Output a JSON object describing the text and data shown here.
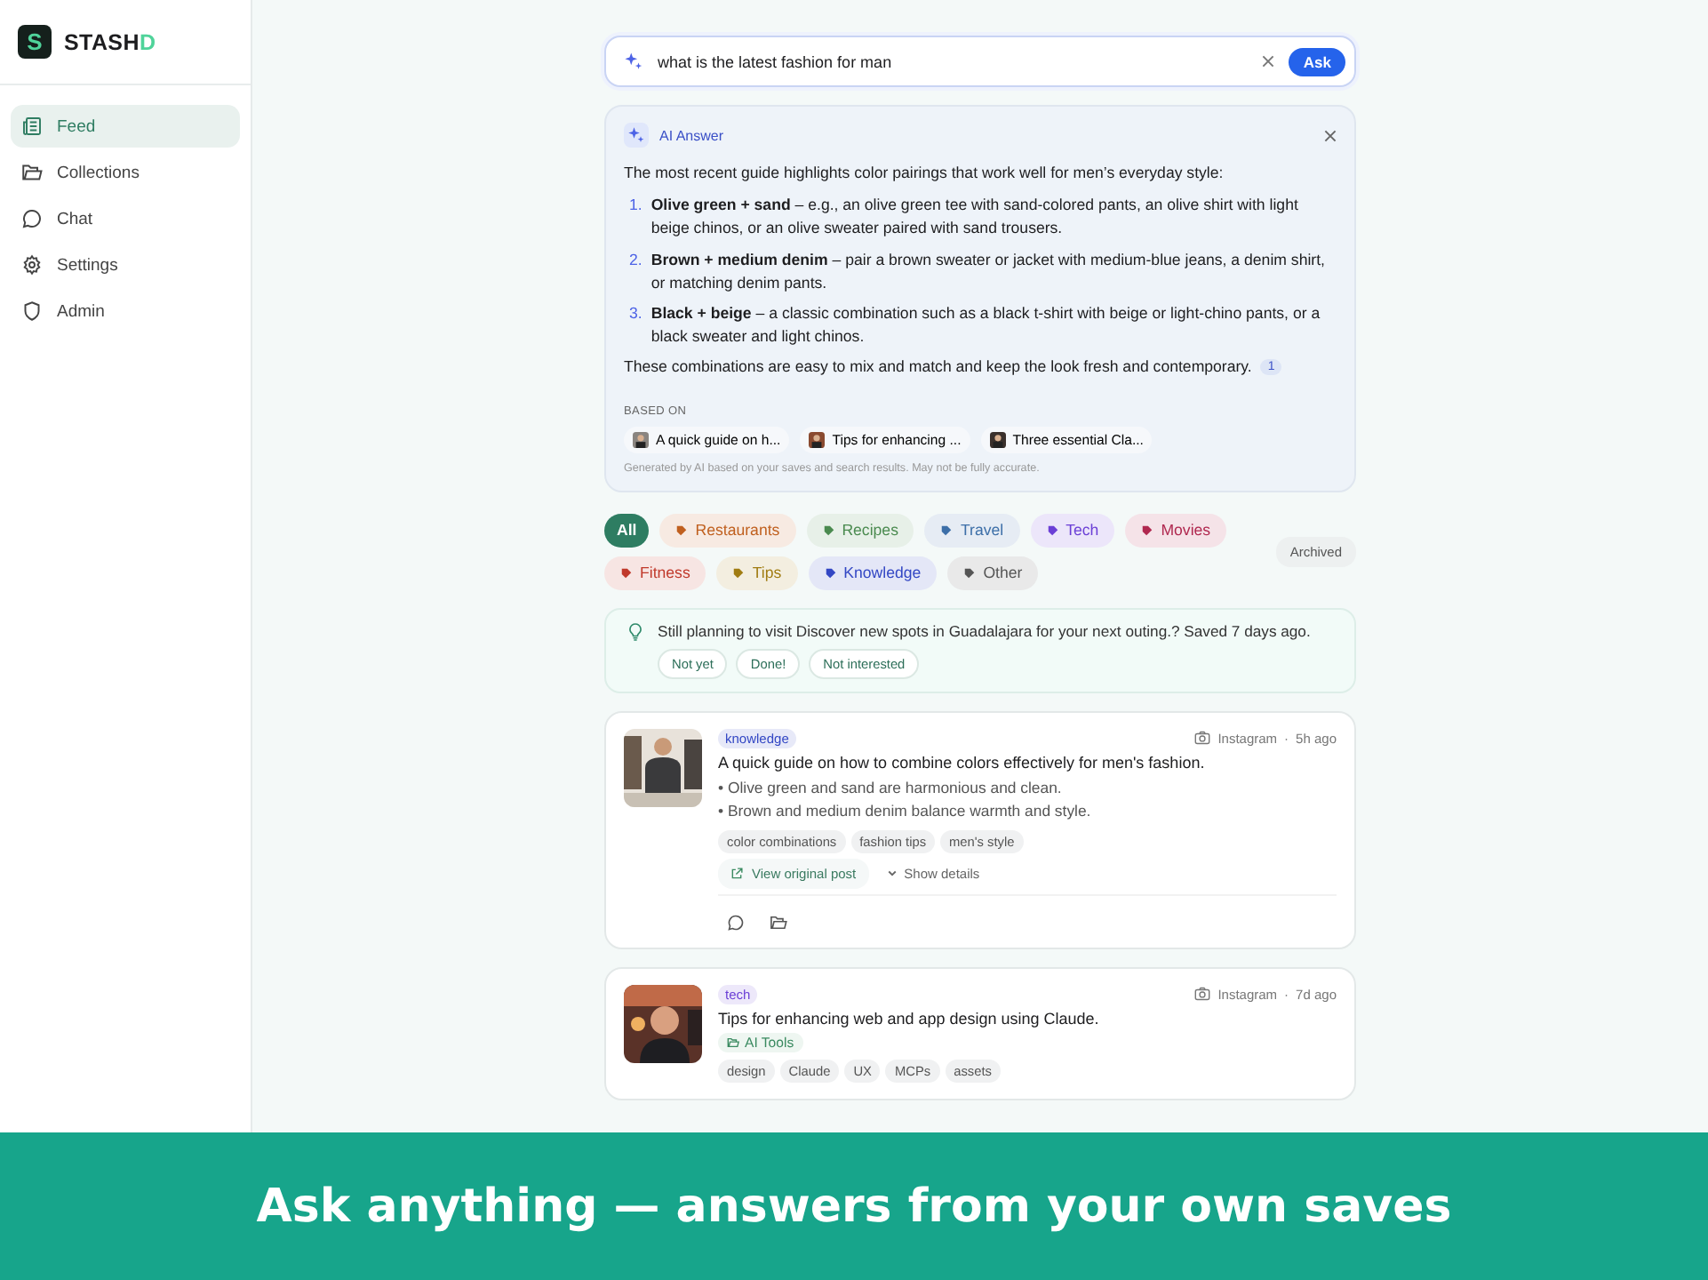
{
  "app": {
    "logo_letter": "S",
    "brand": "STASH",
    "brand_accent": "D"
  },
  "sidebar": {
    "items": [
      {
        "label": "Feed",
        "kind": "feed",
        "selected": true
      },
      {
        "label": "Collections",
        "kind": "folder",
        "selected": false
      },
      {
        "label": "Chat",
        "kind": "chat",
        "selected": false
      },
      {
        "label": "Settings",
        "kind": "gear",
        "selected": false
      },
      {
        "label": "Admin",
        "kind": "shield",
        "selected": false
      }
    ]
  },
  "search": {
    "value": "what is the latest fashion for man",
    "button": "Ask"
  },
  "ai_answer": {
    "title": "AI Answer",
    "intro": "The most recent guide highlights color pairings that work well for men’s everyday style:",
    "points": [
      {
        "number": "1.",
        "lead": "Olive green + sand",
        "text": " – e.g., an olive green tee with sand-colored pants, an olive shirt with light beige chinos, or an olive sweater paired with sand trousers."
      },
      {
        "number": "2.",
        "lead": "Brown + medium denim",
        "text": " – pair a brown sweater or jacket with medium-blue jeans, a denim shirt, or matching denim pants."
      },
      {
        "number": "3.",
        "lead": "Black + beige",
        "text": " – a classic combination such as a black t-shirt with beige or light-chino pants, or a black sweater and light chinos."
      }
    ],
    "conclusion": "These combinations are easy to mix and match and keep the look fresh and contemporary.",
    "citation": "1",
    "based_on_label": "BASED ON",
    "sources": [
      "A quick guide on h...",
      "Tips for enhancing ...",
      "Three essential Cla..."
    ],
    "disclaimer": "Generated by AI based on your saves and search results. May not be fully accurate."
  },
  "categories": [
    {
      "label": "All",
      "selected": true
    },
    {
      "label": "Restaurants",
      "selected": false,
      "color": "#c0601f"
    },
    {
      "label": "Recipes",
      "selected": false,
      "color": "#4a8a4f"
    },
    {
      "label": "Travel",
      "selected": false,
      "color": "#3d6fa8"
    },
    {
      "label": "Tech",
      "selected": false,
      "color": "#6b3fd6"
    },
    {
      "label": "Movies",
      "selected": false,
      "color": "#b0284f"
    },
    {
      "label": "Fitness",
      "selected": false,
      "color": "#c0392b"
    },
    {
      "label": "Tips",
      "selected": false,
      "color": "#a07c12"
    },
    {
      "label": "Knowledge",
      "selected": false,
      "color": "#3347c4"
    },
    {
      "label": "Other",
      "selected": false,
      "color": "#555555"
    }
  ],
  "archived_button": "Archived",
  "reminder": {
    "text": "Still planning to visit Discover new spots in Guadalajara for your next outing.? Saved 7 days ago.",
    "actions": [
      "Not yet",
      "Done!",
      "Not interested"
    ]
  },
  "posts": [
    {
      "category": "knowledge",
      "color": "#3347c4",
      "source": "Instagram",
      "separator": "·",
      "bullet": "•",
      "time": "5h ago",
      "title": "A quick guide on how to combine colors effectively for men's fashion.",
      "bullets": [
        "Olive green and sand are harmonious and clean.",
        "Brown and medium denim balance warmth and style."
      ],
      "tags": [
        "color combinations",
        "fashion tips",
        "men's style"
      ],
      "link": "View original post",
      "details": "Show details"
    },
    {
      "category": "tech",
      "color": "#6b3fd6",
      "source": "Instagram",
      "separator": "·",
      "time": "7d ago",
      "title": "Tips for enhancing web and app design using Claude.",
      "collection": "AI Tools",
      "tags": [
        "design",
        "Claude",
        "UX",
        "MCPs",
        "assets"
      ]
    }
  ],
  "banner": "Ask anything — answers from your own saves"
}
